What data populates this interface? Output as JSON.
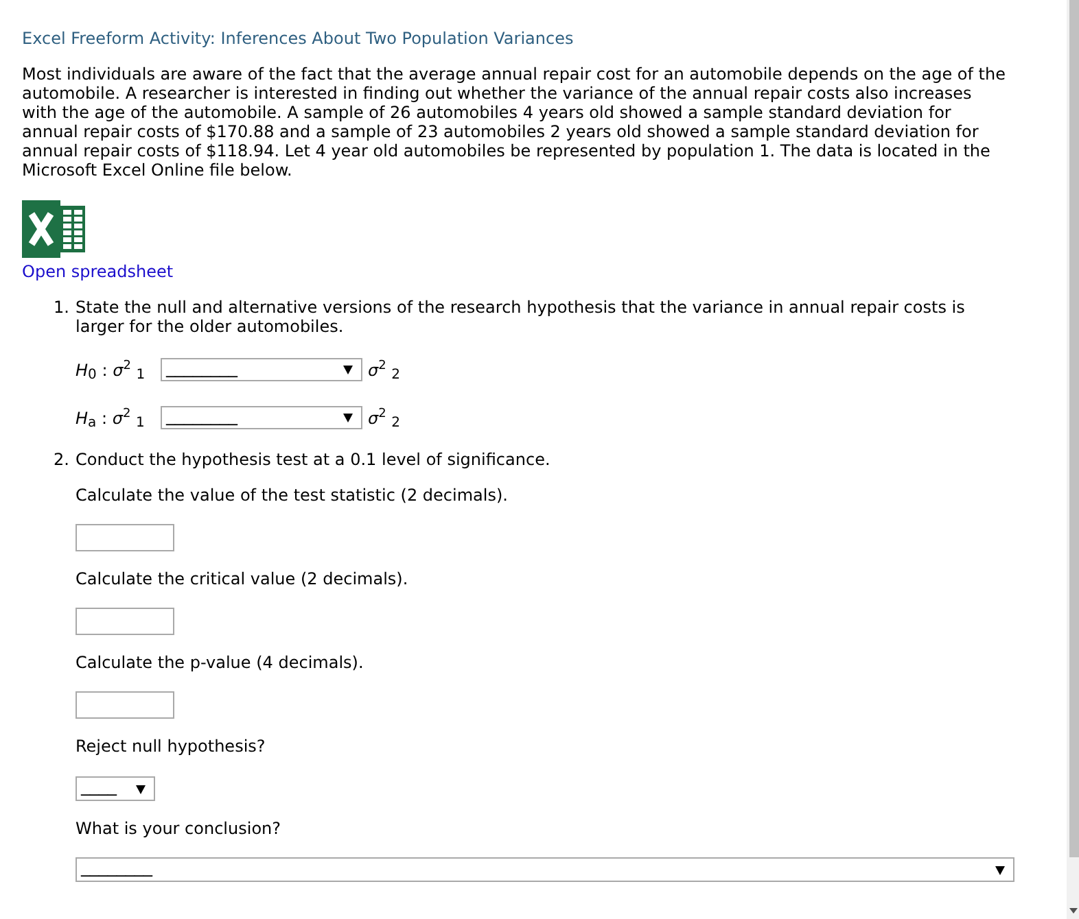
{
  "activity": {
    "title": "Excel Freeform Activity: Inferences About Two Population Variances"
  },
  "intro": "Most individuals are aware of the fact that the average annual repair cost for an automobile depends on the age of the automobile. A researcher is interested in finding out whether the variance of the annual repair costs also increases with the age of the automobile. A sample of 26 automobiles 4 years old showed a sample standard deviation for\nannual repair costs of $170.88 and a sample of 23 automobiles 2 years old showed a sample standard deviation for annual repair costs of $118.94. Let 4 year old automobiles be represented by population 1. The data is located in the Microsoft Excel Online file below.",
  "spreadsheet_link": {
    "label": "Open spreadsheet"
  },
  "question_1": {
    "number": "1.",
    "text": "State the null and alternative versions of the research hypothesis that the variance in annual repair costs is larger for the older automobiles.",
    "hypotheses": [
      {
        "lhs": "*H*$_{0}$ : *σ*$^{2}$ $_{1}$",
        "value": "________",
        "rhs": "*σ*$^{2}$ $_{2}$"
      },
      {
        "lhs": "*H*$_{a}$ : *σ*$^{2}$ $_{1}$",
        "value": "________",
        "rhs": "*σ*$^{2}$ $_{2}$"
      }
    ]
  },
  "question_2": {
    "number": "2.",
    "text": "Conduct the hypothesis test at a 0.1 level of significance.",
    "steps": [
      {
        "kind": "input",
        "prompt": "Calculate the value of the test statistic (2 decimals)."
      },
      {
        "kind": "input",
        "prompt": "Calculate the critical value (2 decimals)."
      },
      {
        "kind": "input",
        "prompt": "Calculate the p-value (4 decimals)."
      },
      {
        "kind": "select",
        "prompt": "Reject null hypothesis?",
        "value": "____"
      },
      {
        "kind": "wide_select",
        "prompt": "What is your conclusion?",
        "value": "________"
      }
    ]
  }
}
